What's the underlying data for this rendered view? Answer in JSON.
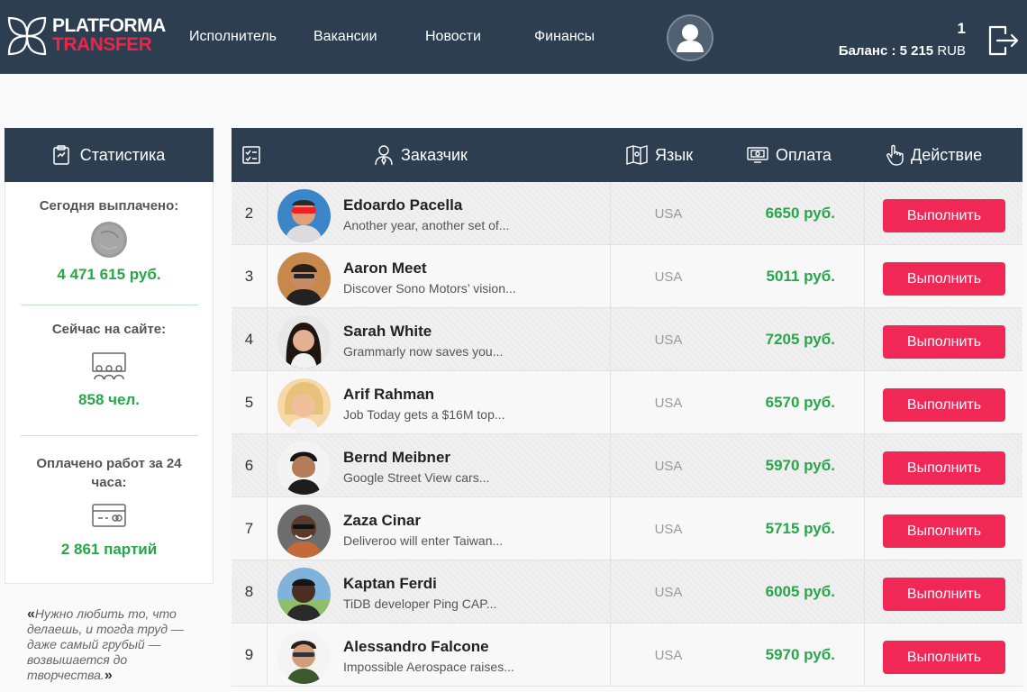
{
  "header": {
    "logo_line1": "PLATFORMA",
    "logo_line2": "TRANSFER",
    "nav": [
      "Исполнитель",
      "Вакансии",
      "Новости",
      "Финансы"
    ],
    "account_number": "1",
    "balance_label": "Баланс : 5 215",
    "balance_currency": "RUB"
  },
  "sidebar": {
    "title": "Статистика",
    "stats": [
      {
        "label": "Сегодня выплачено:",
        "value": "4 471 615 руб.",
        "icon": "coin-icon"
      },
      {
        "label": "Сейчас на сайте:",
        "value": "858 чел.",
        "icon": "audience-icon"
      },
      {
        "label": "Оплачено работ за 24 часа:",
        "value": "2 861 партий",
        "icon": "card-icon"
      }
    ],
    "quote": "Нужно любить то, что делаешь, и тогда труд — даже самый грубый — возвышается до творчества."
  },
  "table": {
    "headers": {
      "client": "Заказчик",
      "language": "Язык",
      "payment": "Оплата",
      "action": "Действие"
    },
    "rows": [
      {
        "num": "2",
        "name": "Edoardo Pacella",
        "desc": "Another year, another set of...",
        "lang": "USA",
        "pay": "6650 руб.",
        "action": "Выполнить"
      },
      {
        "num": "3",
        "name": "Aaron Meet",
        "desc": "Discover Sono Motors’ vision...",
        "lang": "USA",
        "pay": "5011 руб.",
        "action": "Выполнить"
      },
      {
        "num": "4",
        "name": "Sarah White",
        "desc": "Grammarly now saves you...",
        "lang": "USA",
        "pay": "7205 руб.",
        "action": "Выполнить"
      },
      {
        "num": "5",
        "name": "Arif Rahman",
        "desc": "Job Today gets a $16M top...",
        "lang": "USA",
        "pay": "6570 руб.",
        "action": "Выполнить"
      },
      {
        "num": "6",
        "name": "Bernd Meibner",
        "desc": "Google Street View cars...",
        "lang": "USA",
        "pay": "5970 руб.",
        "action": "Выполнить"
      },
      {
        "num": "7",
        "name": "Zaza Cinar",
        "desc": "Deliveroo will enter Taiwan...",
        "lang": "USA",
        "pay": "5715 руб.",
        "action": "Выполнить"
      },
      {
        "num": "8",
        "name": "Kaptan Ferdi",
        "desc": "TiDB developer Ping CAP...",
        "lang": "USA",
        "pay": "6005 руб.",
        "action": "Выполнить"
      },
      {
        "num": "9",
        "name": "Alessandro Falcone",
        "desc": "Impossible Aerospace raises...",
        "lang": "USA",
        "pay": "5970 руб.",
        "action": "Выполнить"
      }
    ]
  },
  "colors": {
    "header_bg": "#2c3e50",
    "accent_red": "#ef2856",
    "money_green": "#27a749"
  }
}
